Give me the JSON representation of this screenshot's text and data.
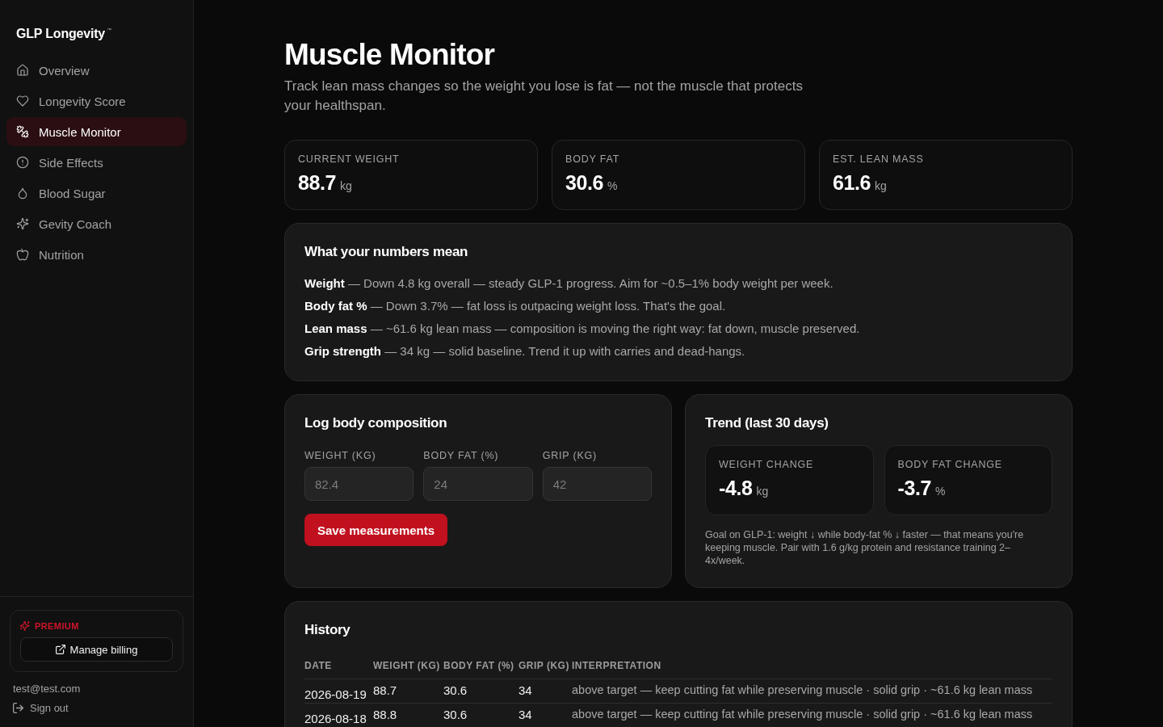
{
  "sidebar": {
    "logo": "GLP Longevity$^{™}$",
    "items": [
      {
        "label": "Overview",
        "selected": false
      },
      {
        "label": "Longevity Score",
        "selected": false
      },
      {
        "label": "Muscle Monitor",
        "selected": true
      },
      {
        "label": "Side Effects",
        "selected": false
      },
      {
        "label": "Blood Sugar",
        "selected": false
      },
      {
        "label": "Gevity Coach",
        "selected": false
      },
      {
        "label": "Nutrition",
        "selected": false
      }
    ],
    "plan": {
      "badge": "PREMIUM",
      "button": "Manage billing"
    },
    "account": {
      "email": "test@test.com",
      "sign_out": "Sign out"
    }
  },
  "header": {
    "title": "Muscle Monitor",
    "subtitle": "Track lean mass changes so the weight you lose is fat — not the muscle that protects your healthspan."
  },
  "stats": [
    {
      "label": "CURRENT WEIGHT",
      "value": "88.7",
      "unit": "kg"
    },
    {
      "label": "BODY FAT",
      "value": "30.6",
      "unit": "%"
    },
    {
      "label": "EST. LEAN MASS",
      "value": "61.6",
      "unit": "kg"
    }
  ],
  "meaning": {
    "title": "What your numbers mean",
    "lines": [
      "**Weight** — Down 4.8 kg overall — steady GLP-1 progress. Aim for ~0.5–1% body weight per week.",
      "**Body fat %** — Down 3.7% — fat loss is outpacing weight loss. That's the goal.",
      "**Lean mass** — ~61.6 kg lean mass — composition is moving the right way: fat down, muscle preserved.",
      "**Grip strength** — 34 kg — solid baseline. Trend it up with carries and dead-hangs."
    ]
  },
  "log": {
    "title": "Log body composition",
    "fields": [
      {
        "label": "WEIGHT (KG)",
        "placeholder": "82.4"
      },
      {
        "label": "BODY FAT (%)",
        "placeholder": "24"
      },
      {
        "label": "GRIP (KG)",
        "placeholder": "42"
      }
    ],
    "button": "Save measurements"
  },
  "trend": {
    "title": "Trend (last 30 days)",
    "stats": [
      {
        "label": "WEIGHT CHANGE",
        "value": "-4.8",
        "unit": "kg"
      },
      {
        "label": "BODY FAT CHANGE",
        "value": "-3.7",
        "unit": "%"
      }
    ],
    "note": "Goal on GLP-1: weight ↓ while body-fat % ↓ faster — that means you're keeping muscle. Pair with 1.6 g/kg protein and resistance training 2–4x/week."
  },
  "history": {
    "title": "History",
    "columns": [
      "DATE",
      "WEIGHT (KG)",
      "BODY FAT (%)",
      "GRIP (KG)",
      "INTERPRETATION"
    ],
    "rows": [
      [
        "2026-08-19",
        "88.7",
        "30.6",
        "34",
        "above target — keep cutting fat while preserving muscle · solid grip · ~61.6 kg lean mass"
      ],
      [
        "2026-08-18",
        "88.8",
        "30.6",
        "34",
        "above target — keep cutting fat while preserving muscle · solid grip · ~61.6 kg lean mass"
      ]
    ]
  }
}
